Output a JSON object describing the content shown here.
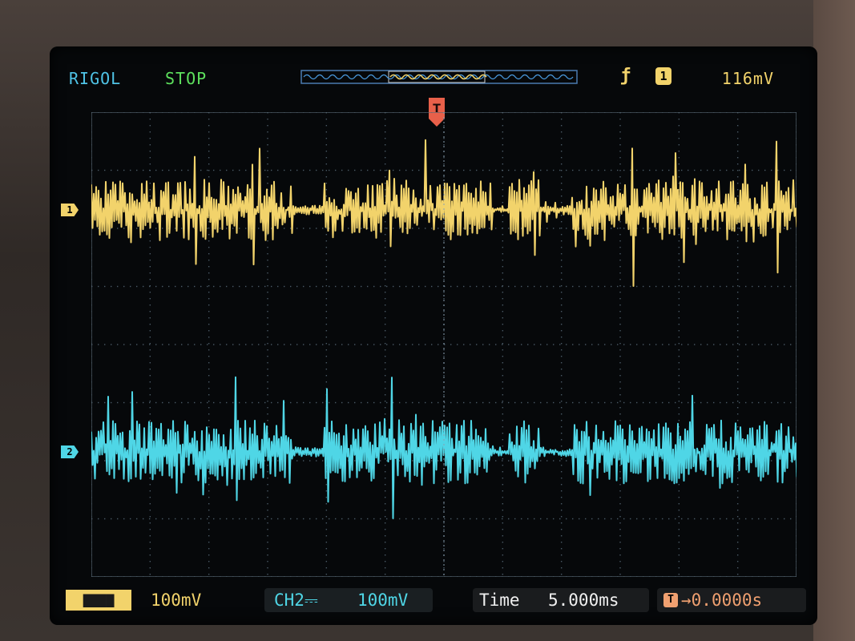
{
  "header": {
    "brand": "RIGOL",
    "run_state": "STOP",
    "trigger_source": "1",
    "trigger_level": "116mV"
  },
  "channels": {
    "ch1": {
      "marker": "1",
      "scale": "100mV"
    },
    "ch2": {
      "marker": "2",
      "label": "CH2",
      "scale": "100mV"
    }
  },
  "timebase": {
    "label": "Time",
    "value": "5.000ms"
  },
  "trigger_offset": {
    "icon": "T",
    "value": "0.0000s"
  },
  "colors": {
    "ch1": "#f2d36b",
    "ch2": "#4fd6e6",
    "grid": "#4a5a66",
    "trigger": "#e8604a"
  }
}
